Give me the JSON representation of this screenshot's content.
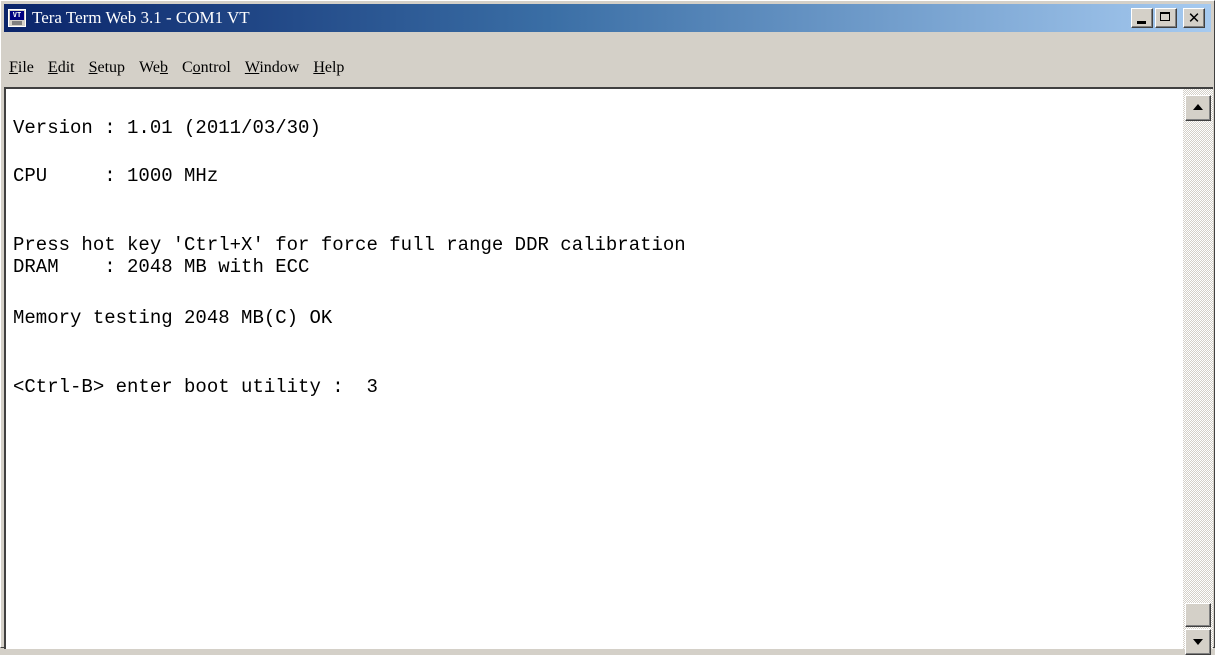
{
  "window": {
    "title": "Tera Term Web 3.1 - COM1 VT",
    "icon": "teraterm-vt-icon",
    "controls": {
      "minimize": "minimize-icon",
      "maximize": "maximize-icon",
      "close_glyph": "✕"
    }
  },
  "menu": {
    "items": [
      {
        "pre": "",
        "key": "F",
        "post": "ile"
      },
      {
        "pre": "",
        "key": "E",
        "post": "dit"
      },
      {
        "pre": "",
        "key": "S",
        "post": "etup"
      },
      {
        "pre": "We",
        "key": "b",
        "post": ""
      },
      {
        "pre": "C",
        "key": "o",
        "post": "ntrol"
      },
      {
        "pre": "",
        "key": "W",
        "post": "indow"
      },
      {
        "pre": "",
        "key": "H",
        "post": "elp"
      }
    ]
  },
  "terminal": {
    "lines": [
      "Version : 1.01 (2011/03/30)",
      "CPU     : 1000 MHz",
      "Press hot key 'Ctrl+X' for force full range DDR calibration",
      "DRAM    : 2048 MB with ECC",
      "Memory testing 2048 MB(C) OK",
      "<Ctrl-B> enter boot utility :  3"
    ]
  },
  "colors": {
    "title_gradient_start": "#0a246a",
    "title_gradient_end": "#a6caf0",
    "terminal_background": "#ffffff",
    "terminal_text": "#000000",
    "chrome": "#d4d0c8"
  }
}
